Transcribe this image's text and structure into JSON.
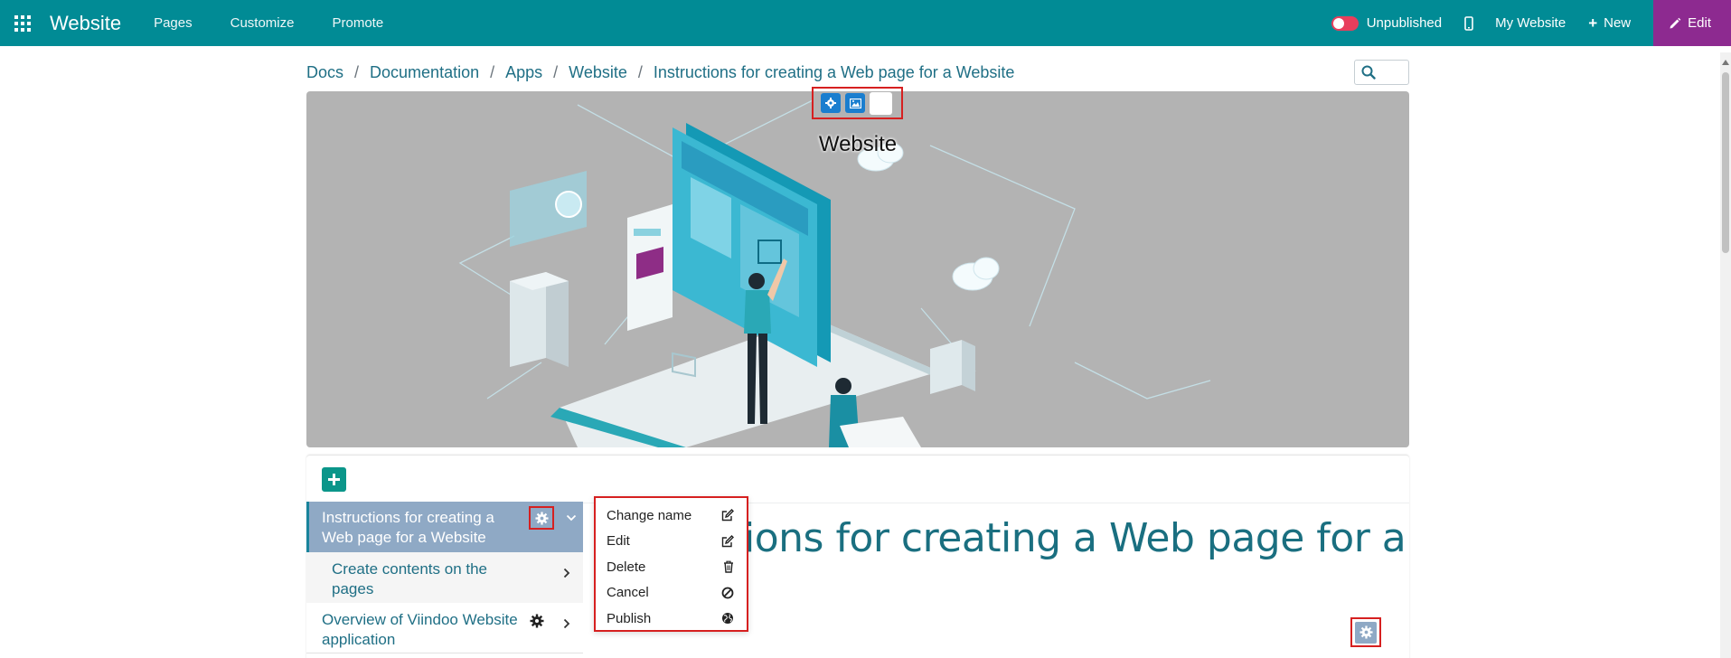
{
  "navbar": {
    "brand": "Website",
    "menu": [
      "Pages",
      "Customize",
      "Promote"
    ],
    "publish_status": "Unpublished",
    "site_name": "My Website",
    "new_label": "New",
    "edit_label": "Edit",
    "colors": {
      "bar": "#018b95",
      "edit": "#8d2a90",
      "toggle": "#e83e5c"
    }
  },
  "breadcrumb": [
    "Docs",
    "Documentation",
    "Apps",
    "Website",
    "Instructions for creating a Web page for a Website"
  ],
  "hero": {
    "title": "Website"
  },
  "sidebar": {
    "items": [
      {
        "label": "Instructions for creating a Web page for a Website",
        "active": true
      },
      {
        "label": "Create contents on the pages",
        "active": false
      },
      {
        "label": "Overview of Viindoo Website application",
        "active": false
      }
    ]
  },
  "main": {
    "title": "ions for creating a Web page for a"
  },
  "context_menu": {
    "items": [
      {
        "label": "Change name",
        "icon": "edit-icon"
      },
      {
        "label": "Edit",
        "icon": "edit-icon"
      },
      {
        "label": "Delete",
        "icon": "trash-icon"
      },
      {
        "label": "Cancel",
        "icon": "ban-icon"
      },
      {
        "label": "Publish",
        "icon": "globe-icon"
      }
    ]
  }
}
